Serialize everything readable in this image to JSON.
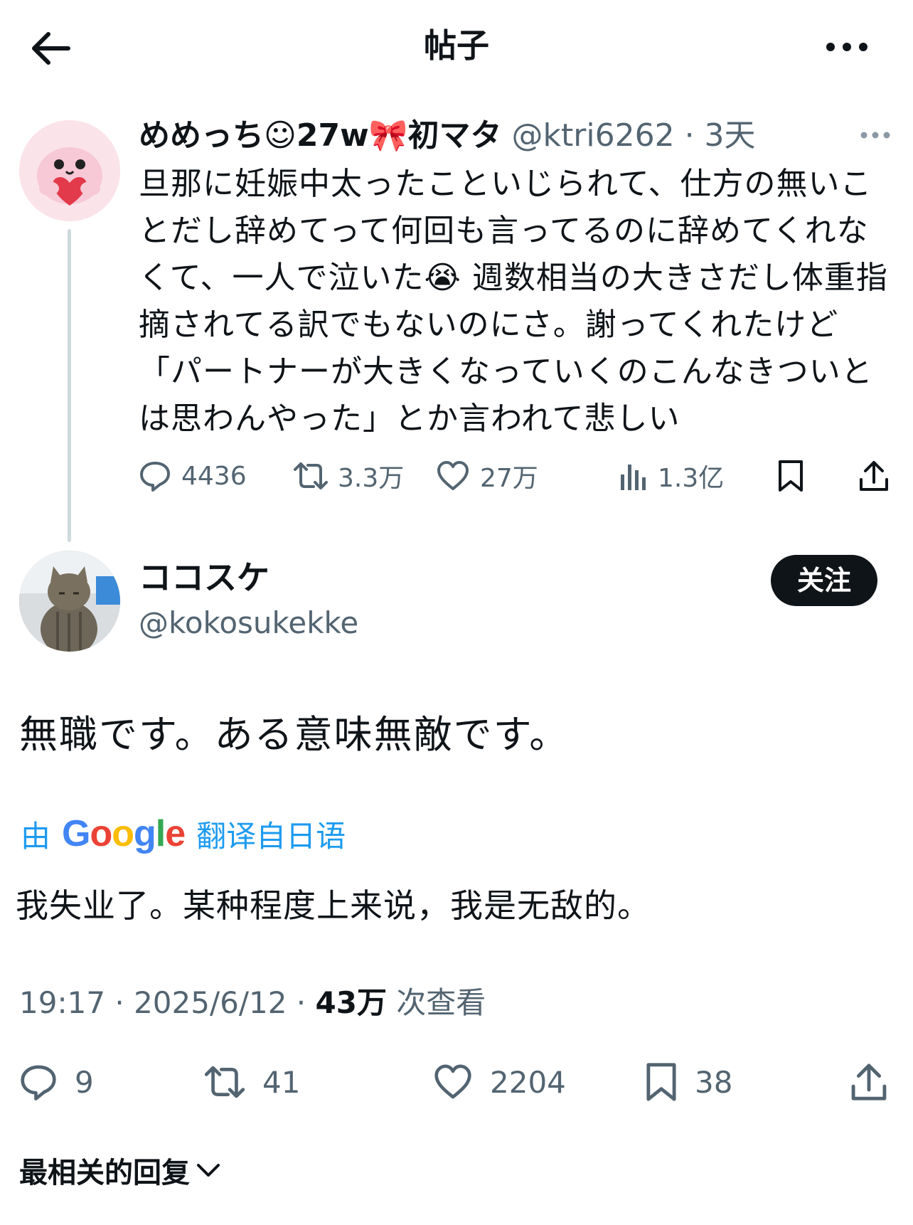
{
  "header": {
    "title": "帖子"
  },
  "quoted_post": {
    "display_name": "めめっち☺27w🎀初マタ",
    "handle": "@ktri6262",
    "time": "· 3天",
    "text": "旦那に妊娠中太ったこといじられて、仕方の無いことだし辞めてって何回も言ってるのに辞めてくれなくて、一人で泣いた😭 週数相当の大きさだし体重指摘されてる訳でもないのにさ。謝ってくれたけど「パートナーが大きくなっていくのこんなきついとは思わんやった」とか言われて悲しい",
    "replies": "4436",
    "reposts": "3.3万",
    "likes": "27万",
    "views": "1.3亿"
  },
  "main_post": {
    "display_name": "ココスケ",
    "handle": "@kokosukekke",
    "follow_label": "关注",
    "text": "無職です。ある意味無敵です。",
    "translate_prefix": "由",
    "translate_brand": "Google",
    "translate_suffix": "翻译自日语",
    "translated_text": "我失业了。某种程度上来说，我是无敌的。",
    "time": "19:17 · 2025/6/12 · ",
    "views_count": "43万",
    "views_label": " 次查看",
    "replies": "9",
    "reposts": "41",
    "likes": "2204",
    "bookmarks": "38"
  },
  "replies_sort": {
    "label": "最相关的回复"
  },
  "colors": {
    "accent": "#1d9bf0",
    "text": "#0f1419",
    "secondary": "#536471",
    "divider": "#cfd9de"
  }
}
